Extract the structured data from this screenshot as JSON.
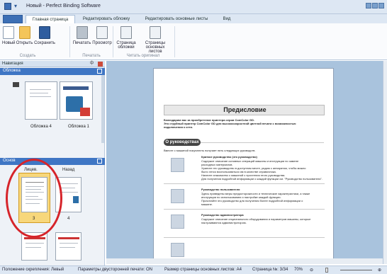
{
  "window": {
    "title": "Новый - Perfect Binding Software"
  },
  "tabs": [
    {
      "label": ""
    },
    {
      "label": "Главная страница"
    },
    {
      "label": "Редактировать обложку"
    },
    {
      "label": "Редактировать основные листы"
    },
    {
      "label": "Вид"
    }
  ],
  "ribbon": {
    "buttons": [
      {
        "label": "Новый",
        "icon": "new-document-icon"
      },
      {
        "label": "Открыть",
        "icon": "open-folder-icon"
      },
      {
        "label": "Сохранить",
        "icon": "save-icon"
      },
      {
        "label": "Печатать",
        "icon": "printer-icon"
      },
      {
        "label": "Просмотр",
        "icon": "print-preview-icon"
      },
      {
        "label": "Страница обложки",
        "icon": "cover-page-icon"
      },
      {
        "label": "Страницы основных листов",
        "icon": "body-pages-icon"
      }
    ],
    "groups": [
      "Создать",
      "Печатать",
      "Читать оригинал"
    ]
  },
  "nav": {
    "title": "Навигация",
    "pin": "ф",
    "cover_section": "Обложка",
    "cover_captions": [
      "Обложка 4",
      "Обложка 1"
    ],
    "body_section": "Основ",
    "columns": [
      "Лицев.",
      "Назад"
    ],
    "page_numbers": [
      "3",
      "4"
    ]
  },
  "document": {
    "heading": "Предисловие",
    "intro": [
      "Благодарим вас за приобретение принтера серии ComColor GD.",
      "Это струйный принтер ComColor GD для высокоскоростной цветной печати с возможностью",
      "подключения к сети."
    ],
    "section_pill": "О руководствах",
    "section_intro": "Вместе с машиной покупатель получает пять следующих руководств.",
    "items": [
      {
        "title": "Краткое руководство (это руководство)",
        "lines": [
          "Содержит описание основных операций машины и инструкции по замене",
          "расходных материалов.",
          "Храните это руководство в доступном месте, рядом с аппаратом, чтобы можно",
          "было легко воспользоваться им в качестве справочника.",
          "Начните знакомство с машиной с прочтения этого руководства.",
          "Для получения подробной информации о каждой функции см. \"Руководство пользователя\"."
        ]
      },
      {
        "title": "Руководство пользователя",
        "lines": [
          "Здесь приведены меры предосторожности и технические характеристики, а также",
          "инструкции по использованию и настройке каждой функции.",
          "Прочитайте это руководство для получения более подробной информации о",
          "машине."
        ]
      },
      {
        "title": "Руководство администратора",
        "lines": [
          "Содержит описание опционального оборудования и параметров машины, которые",
          "настраиваются администратором."
        ]
      }
    ]
  },
  "status": {
    "binding": "Положение скрепления: Левый",
    "duplex": "Параметры двусторонней печати: ON",
    "size": "Размер страницы основных листов: A4",
    "page": "Страница №: 3/34",
    "zoom": "70%",
    "zoom_minus": "⊖",
    "zoom_plus": "⊕"
  },
  "colors": {
    "accent": "#3f76c4",
    "selection": "#f7d77b",
    "annotation": "#d6242a"
  }
}
